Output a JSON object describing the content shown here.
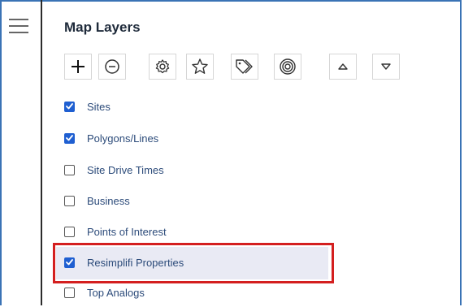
{
  "panel": {
    "title": "Map Layers"
  },
  "toolbar": {
    "buttons": [
      {
        "name": "add-layer-button",
        "icon": "plus-icon"
      },
      {
        "name": "remove-layer-button",
        "icon": "minus-circle-icon"
      },
      {
        "name": "settings-button",
        "icon": "gear-icon"
      },
      {
        "name": "favorite-button",
        "icon": "star-icon"
      },
      {
        "name": "labels-button",
        "icon": "tags-icon"
      },
      {
        "name": "target-button",
        "icon": "target-icon"
      },
      {
        "name": "move-up-button",
        "icon": "triangle-up-icon"
      },
      {
        "name": "move-down-button",
        "icon": "triangle-down-icon"
      }
    ]
  },
  "layers": [
    {
      "label": "Sites",
      "checked": true
    },
    {
      "label": "Polygons/Lines",
      "checked": true
    },
    {
      "label": "Site Drive Times",
      "checked": false
    },
    {
      "label": "Business",
      "checked": false
    },
    {
      "label": "Points of Interest",
      "checked": false
    },
    {
      "label": "Resimplifi Properties",
      "checked": true,
      "highlighted": true
    },
    {
      "label": "Top Analogs",
      "checked": false
    }
  ],
  "colors": {
    "accent": "#1f5fd1",
    "highlight_border": "#d41f1f",
    "frame_border": "#3a73b5",
    "label_text": "#2c4b7a"
  }
}
